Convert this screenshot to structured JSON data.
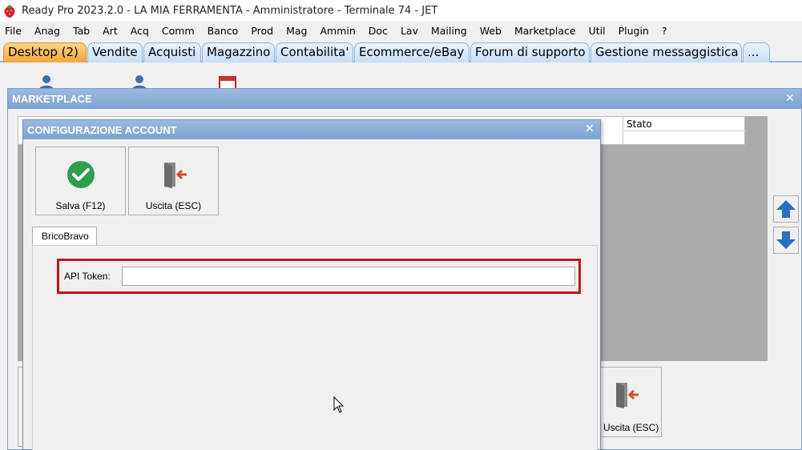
{
  "window": {
    "title": "Ready Pro 2023.2.0 - LA MIA FERRAMENTA - Amministratore - Terminale 74 - JET"
  },
  "menubar": {
    "items": [
      "File",
      "Anag",
      "Tab",
      "Art",
      "Acq",
      "Comm",
      "Banco",
      "Prod",
      "Mag",
      "Ammin",
      "Doc",
      "Lav",
      "Mailing",
      "Web",
      "Marketplace",
      "Util",
      "Plugin",
      "?"
    ]
  },
  "tabs": {
    "items": [
      "Desktop (2)",
      "Vendite",
      "Acquisti",
      "Magazzino",
      "Contabilita'",
      "Ecommerce/eBay",
      "Forum di supporto",
      "Gestione messaggistica",
      "..."
    ],
    "active": "Desktop (2)"
  },
  "marketplace_window": {
    "title": "MARKETPLACE",
    "grid": {
      "columns": [
        "Stato"
      ]
    },
    "exit_button_label": "Uscita (ESC)"
  },
  "dialog": {
    "title": "CONFIGURAZIONE ACCOUNT",
    "toolbar": {
      "save_label": "Salva (F12)",
      "exit_label": "Uscita (ESC)"
    },
    "page_tab": "BricoBravo",
    "api_token": {
      "label": "API Token:",
      "value": ""
    }
  },
  "colors": {
    "accent": "#7ea3d0",
    "active_tab": "#f3a63c",
    "highlight": "#c0141c",
    "save_icon": "#2e9e4f",
    "arrow_icon": "#2a6fc0"
  },
  "icons": [
    "strawberry-app-icon",
    "user-icon",
    "calendar-icon",
    "check-circle-icon",
    "exit-door-icon",
    "arrow-up-icon",
    "arrow-down-icon",
    "mouse-cursor-icon"
  ]
}
